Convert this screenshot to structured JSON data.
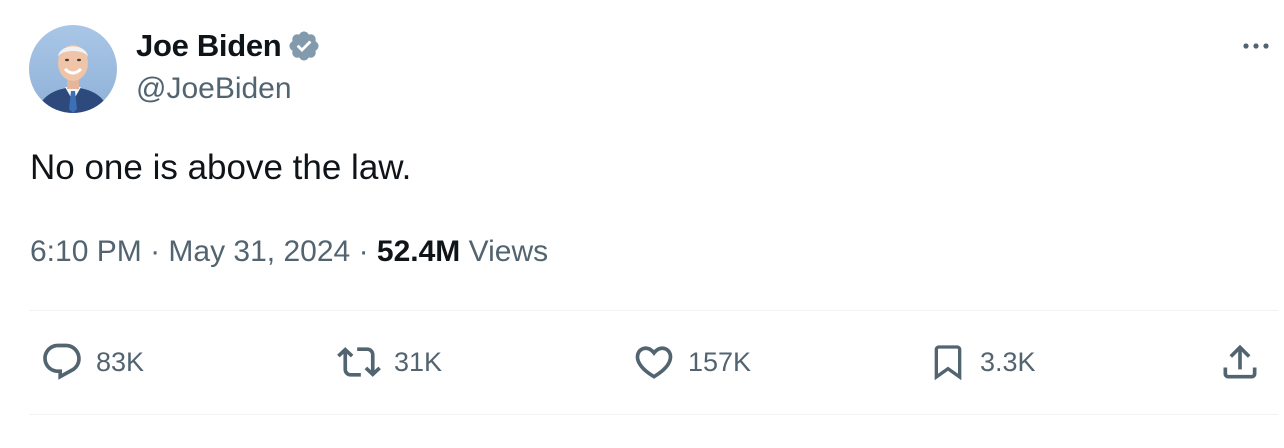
{
  "author": {
    "display_name": "Joe Biden",
    "handle": "@JoeBiden",
    "verified_icon": "verified-badge-icon",
    "avatar_icon": "profile-photo"
  },
  "tweet": {
    "text": "No one is above the law."
  },
  "meta": {
    "time": "6:10 PM",
    "separator": "·",
    "date": "May 31, 2024",
    "views_count": "52.4M",
    "views_label": "Views"
  },
  "actions": {
    "reply": {
      "icon": "reply-icon",
      "count": "83K"
    },
    "retweet": {
      "icon": "retweet-icon",
      "count": "31K"
    },
    "like": {
      "icon": "heart-icon",
      "count": "157K"
    },
    "bookmark": {
      "icon": "bookmark-icon",
      "count": "3.3K"
    },
    "share": {
      "icon": "share-icon"
    }
  },
  "colors": {
    "verified": "#829aab",
    "secondary_text": "#536471",
    "primary_text": "#0f1419",
    "divider": "#eff3f4"
  }
}
